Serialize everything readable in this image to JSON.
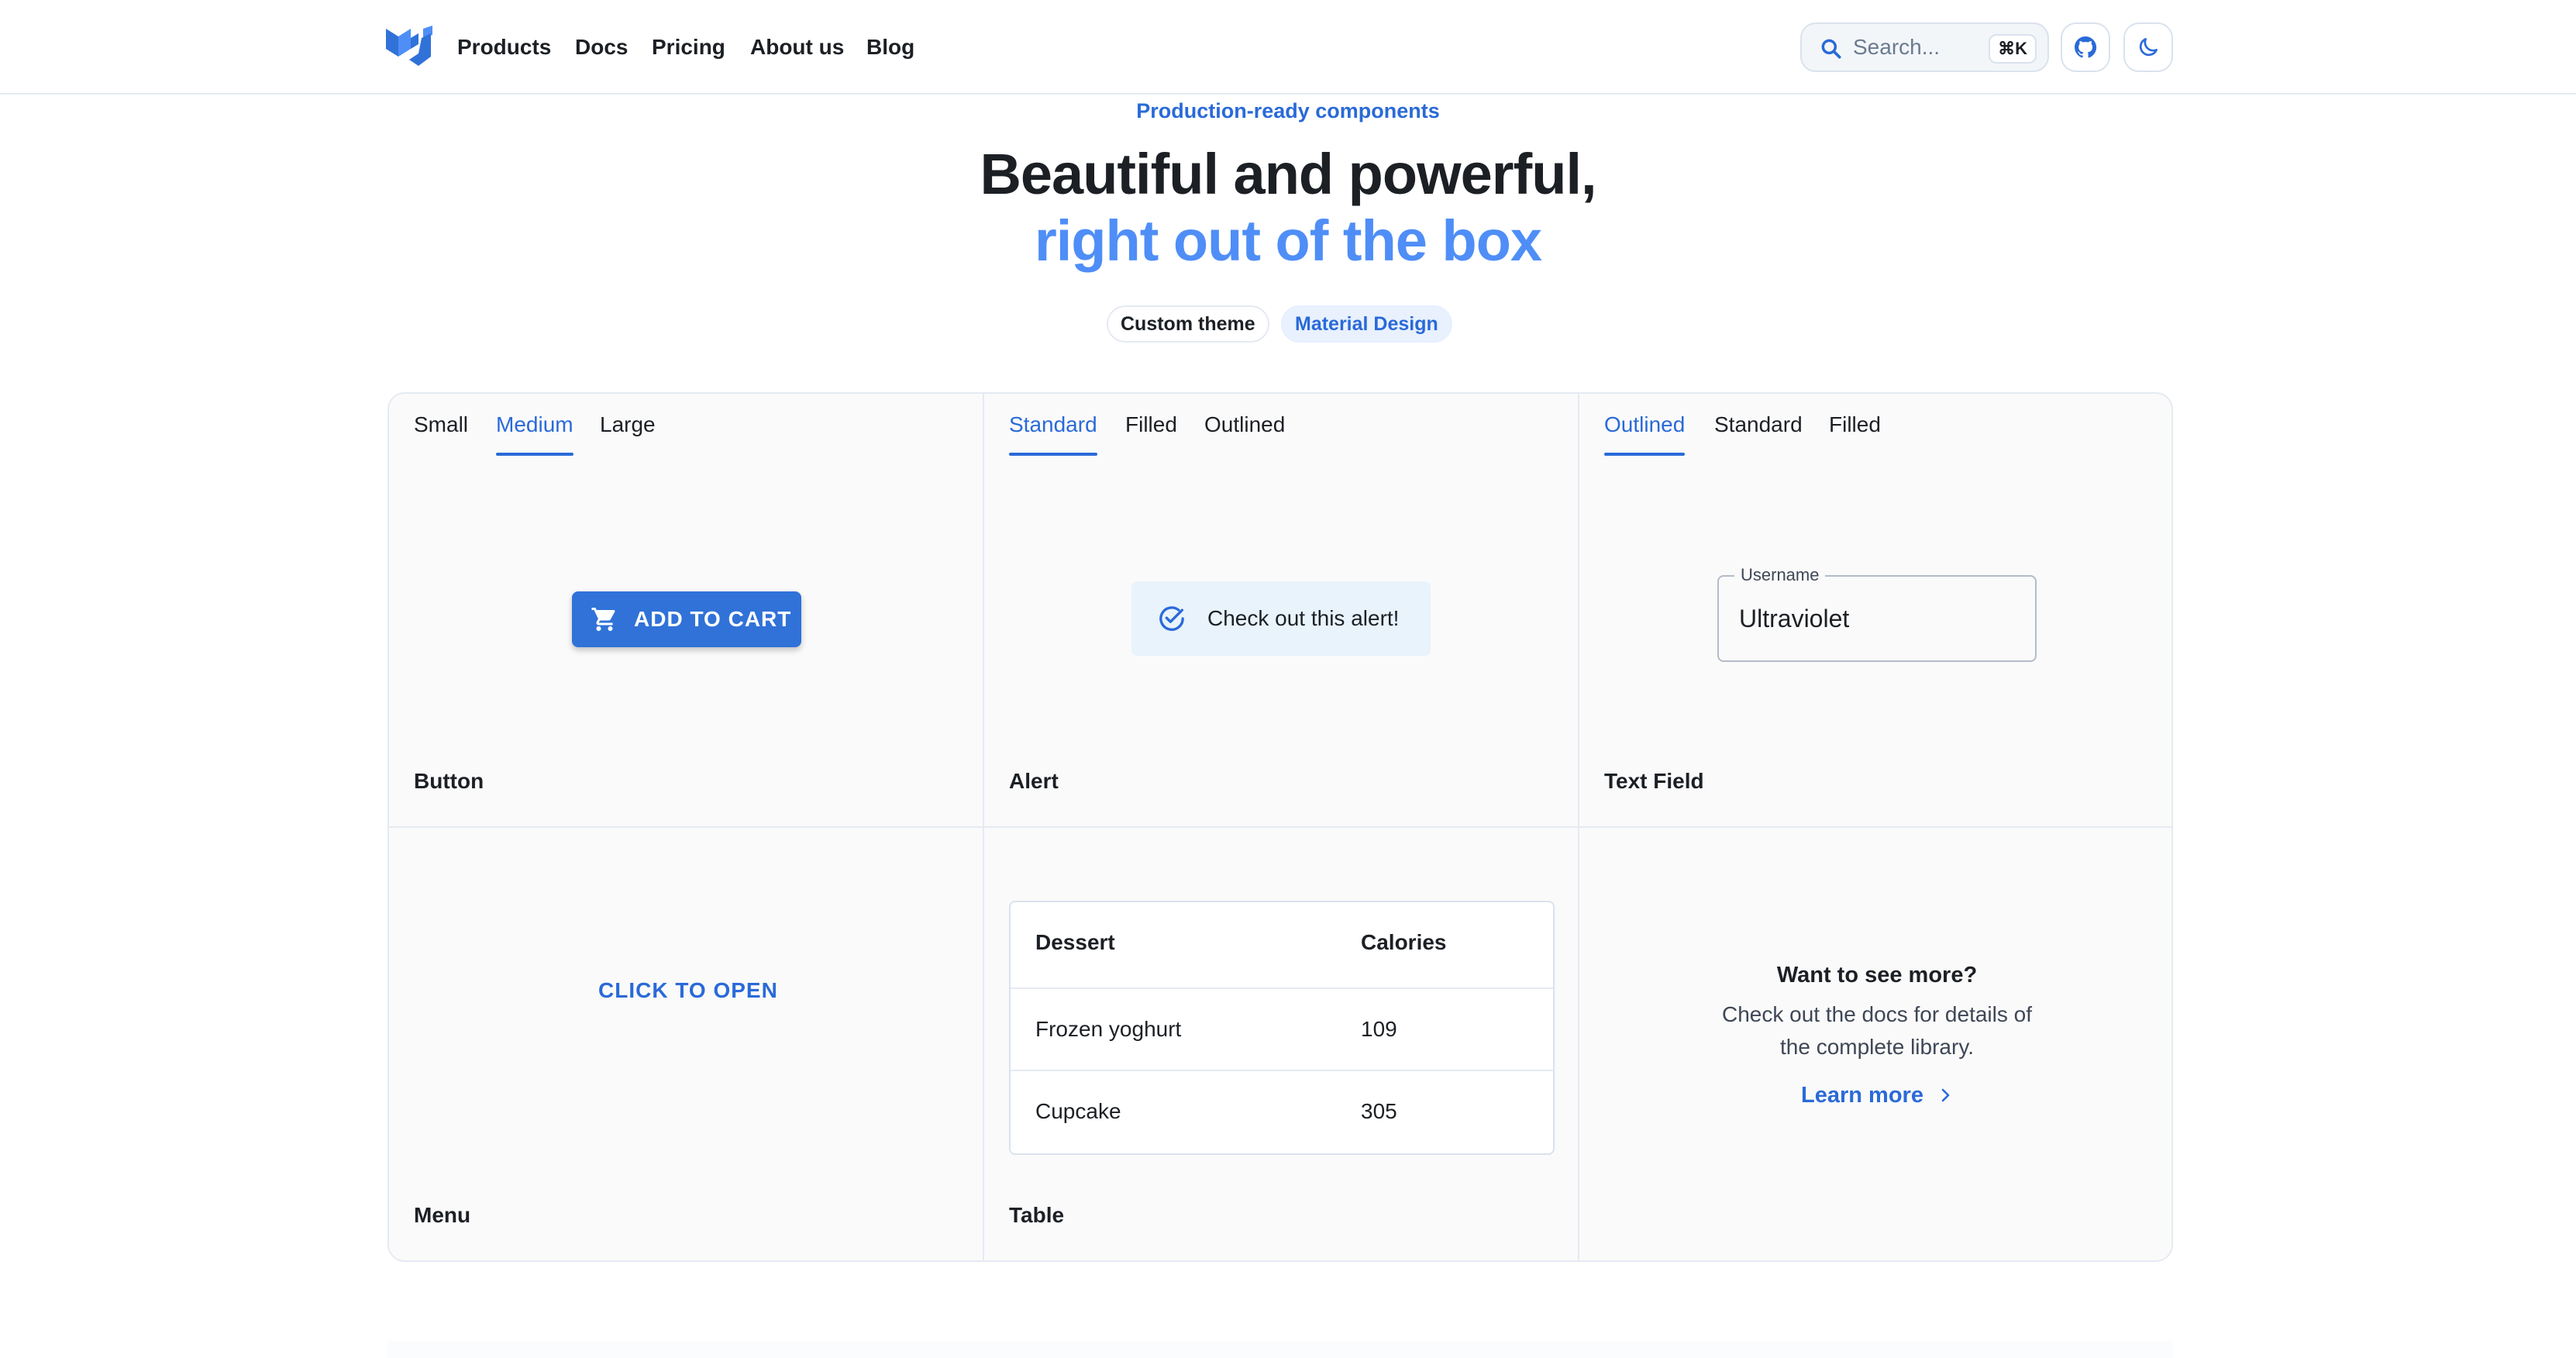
{
  "header": {
    "logo_icon": "mui-logo-icon",
    "nav": [
      "Products",
      "Docs",
      "Pricing",
      "About us",
      "Blog"
    ],
    "search": {
      "placeholder": "Search...",
      "shortcut": "⌘K"
    },
    "github_icon": "github-icon",
    "theme_icon": "moon-icon"
  },
  "hero": {
    "overline": "Production-ready components",
    "title_line1": "Beautiful and powerful,",
    "title_line2": "right out of the box",
    "chips": [
      "Custom theme",
      "Material Design"
    ]
  },
  "demos": {
    "button": {
      "tabs": [
        "Small",
        "Medium",
        "Large"
      ],
      "active_tab": "Medium",
      "button_label": "ADD TO CART",
      "button_icon": "cart-icon",
      "title": "Button"
    },
    "alert": {
      "tabs": [
        "Standard",
        "Filled",
        "Outlined"
      ],
      "active_tab": "Standard",
      "message": "Check out this alert!",
      "icon": "check-circle-icon",
      "title": "Alert"
    },
    "text_field": {
      "tabs": [
        "Outlined",
        "Standard",
        "Filled"
      ],
      "active_tab": "Outlined",
      "label": "Username",
      "value": "Ultraviolet",
      "title": "Text Field"
    },
    "menu": {
      "button_label": "CLICK TO OPEN",
      "title": "Menu"
    },
    "table": {
      "columns": [
        "Dessert",
        "Calories"
      ],
      "rows": [
        [
          "Frozen yoghurt",
          "109"
        ],
        [
          "Cupcake",
          "305"
        ]
      ],
      "title": "Table"
    },
    "more": {
      "title": "Want to see more?",
      "text": "Check out the docs for details of the complete library.",
      "link": "Learn more",
      "link_icon": "chevron-right-icon"
    }
  },
  "colors": {
    "primary": "#2a6ad8",
    "accent_light": "#4f8ef7",
    "text": "#1c2025",
    "border": "#e5eaf2"
  }
}
